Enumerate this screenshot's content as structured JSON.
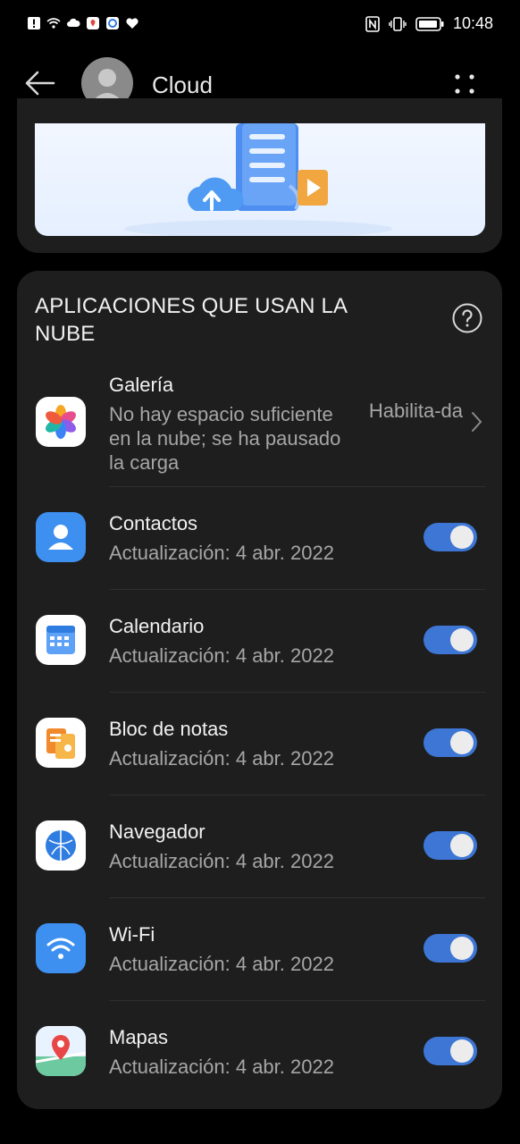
{
  "status_bar": {
    "time": "10:48"
  },
  "header": {
    "title": "Cloud"
  },
  "section": {
    "title": "APLICACIONES QUE USAN LA NUBE"
  },
  "apps": [
    {
      "name": "Galería",
      "subtitle": "No hay espacio suficiente en la nube; se ha pausado la carga",
      "status": "Habilita-da",
      "icon": "gallery-icon"
    },
    {
      "name": "Contactos",
      "subtitle": "Actualización: 4 abr. 2022",
      "enabled": true,
      "icon": "contacts-icon"
    },
    {
      "name": "Calendario",
      "subtitle": "Actualización: 4 abr. 2022",
      "enabled": true,
      "icon": "calendar-icon"
    },
    {
      "name": "Bloc de notas",
      "subtitle": "Actualización: 4 abr. 2022",
      "enabled": true,
      "icon": "notepad-icon"
    },
    {
      "name": "Navegador",
      "subtitle": "Actualización: 4 abr. 2022",
      "enabled": true,
      "icon": "browser-icon"
    },
    {
      "name": "Wi-Fi",
      "subtitle": "Actualización: 4 abr. 2022",
      "enabled": true,
      "icon": "wifi-icon"
    },
    {
      "name": "Mapas",
      "subtitle": "Actualización: 4 abr. 2022",
      "enabled": true,
      "icon": "maps-icon"
    }
  ],
  "colors": {
    "background": "#000000",
    "card": "#1e1e1e",
    "accent": "#3d76d4",
    "secondary_text": "#a6a6a6"
  }
}
